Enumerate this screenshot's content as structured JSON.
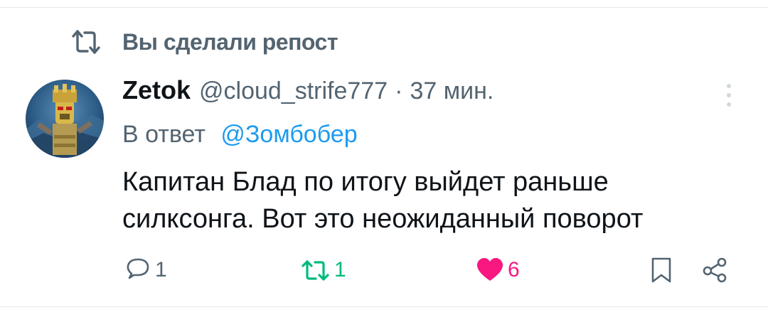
{
  "repost_banner": {
    "label": "Вы сделали репост",
    "icon": "repost-icon"
  },
  "author": {
    "display_name": "Zetok",
    "handle": "@cloud_strife777",
    "separator": "·",
    "time": "37 мин."
  },
  "reply_to": {
    "prefix": "В ответ",
    "mention": "@Зомбобер"
  },
  "tweet": {
    "lines": [
      "Капитан Блад по итогу выйдет раньше",
      "силксонга. Вот это неожиданный поворот"
    ]
  },
  "actions": {
    "reply_count": "1",
    "retweet_count": "1",
    "like_count": "6"
  },
  "colors": {
    "text": "#0f1419",
    "secondary": "#536471",
    "link": "#1d9bf0",
    "retweet_active": "#00ba7c",
    "like_active": "#f91880"
  }
}
